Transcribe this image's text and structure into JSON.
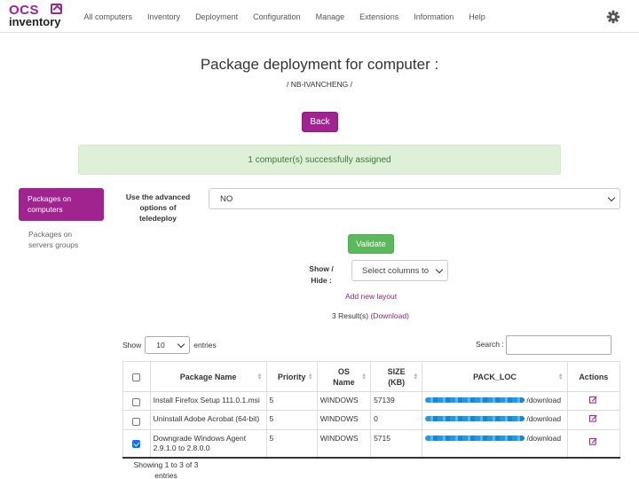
{
  "app": {
    "logo_top": "OCS",
    "logo_bottom": "inventory"
  },
  "nav": {
    "items": [
      "All computers",
      "Inventory",
      "Deployment",
      "Configuration",
      "Manage",
      "Extensions",
      "Information",
      "Help"
    ]
  },
  "header": {
    "title": "Package deployment for computer :",
    "computer": "/ NB-IVANCHENG /"
  },
  "back_label": "Back",
  "alert": "1 computer(s) successfully assigned",
  "sidebar": {
    "items": [
      {
        "label": "Packages on computers",
        "active": true
      },
      {
        "label": "Packages on servers groups",
        "active": false
      }
    ]
  },
  "teledeploy": {
    "label": "Use the advanced options of teledeploy",
    "value": "NO"
  },
  "validate_label": "Validate",
  "columns": {
    "label": "Show / Hide :",
    "placeholder": "Select columns to"
  },
  "add_layout": "Add new layout",
  "results": {
    "text": "3 Result(s)",
    "download": "(Download)"
  },
  "entries": {
    "show": "Show",
    "value": "10",
    "suffix": "entries"
  },
  "search": {
    "label": "Search :"
  },
  "table": {
    "headers": [
      "Package Name",
      "Priority",
      "OS Name",
      "SIZE (KB)",
      "PACK_LOC",
      "Actions"
    ],
    "rows": [
      {
        "checked": false,
        "name": "Install Firefox Setup 111.0.1.msi",
        "priority": "5",
        "os": "WINDOWS",
        "size": "57139",
        "pack_suffix": "/download"
      },
      {
        "checked": false,
        "name": "Uninstall Adobe Acrobat (64-bit)",
        "priority": "5",
        "os": "WINDOWS",
        "size": "0",
        "pack_suffix": "/download"
      },
      {
        "checked": true,
        "name": "Downgrade Windows Agent 2.9.1.0 to 2.8.0.0",
        "priority": "5",
        "os": "WINDOWS",
        "size": "5715",
        "pack_suffix": "/download"
      }
    ]
  },
  "footer": "Showing 1 to 3 of 3 entries",
  "colors": {
    "brand": "#a0238f",
    "success_bg": "#dff0d8",
    "success_text": "#3c763d",
    "validate": "#5cb85c",
    "checkbox": "#0075ff"
  }
}
